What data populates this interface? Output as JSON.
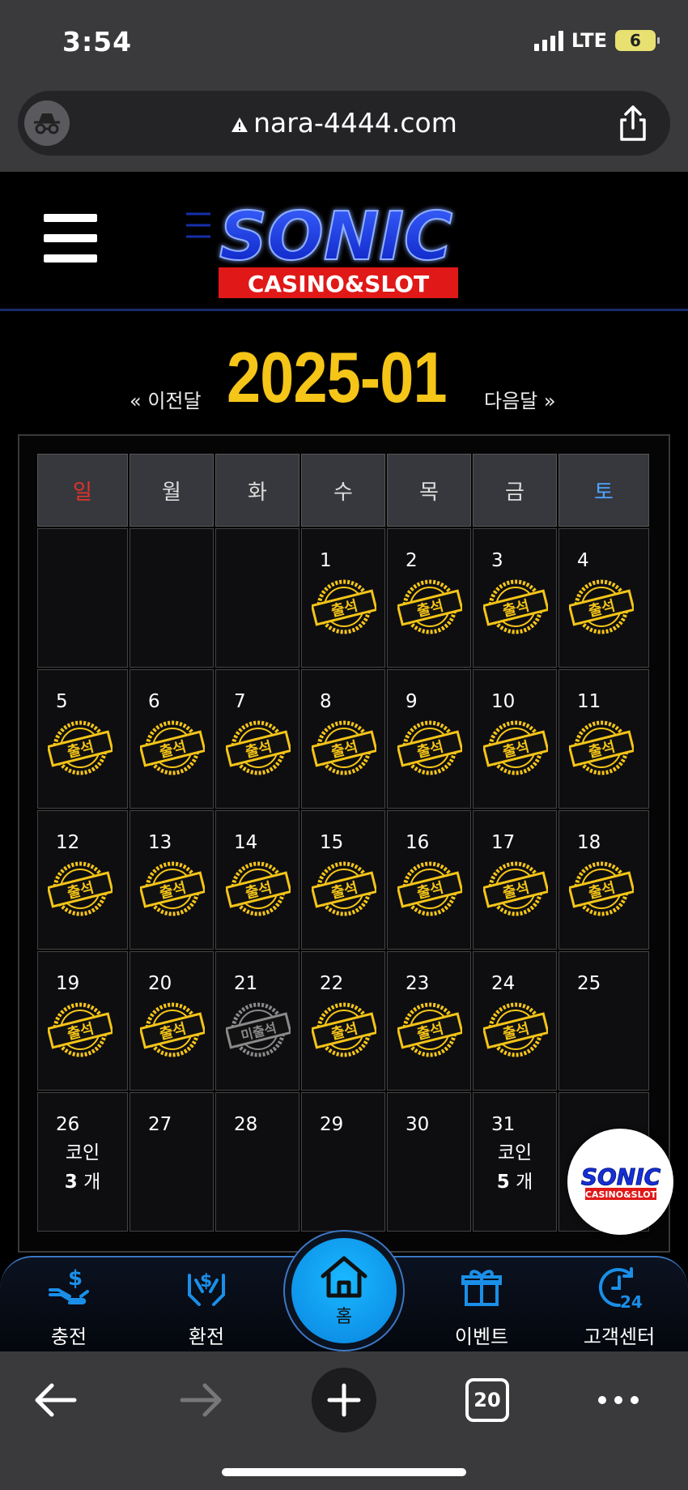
{
  "status_bar": {
    "time": "3:54",
    "network": "LTE",
    "battery": "6"
  },
  "browser": {
    "url": "nara-4444.com",
    "tabs_count": "20"
  },
  "site": {
    "logo_text": "SONIC",
    "logo_sub": "CASINO&SLOT"
  },
  "calendar": {
    "prev_label": "« 이전달",
    "next_label": "다음달 »",
    "month_title": "2025-01",
    "weekdays": [
      "일",
      "월",
      "화",
      "수",
      "목",
      "금",
      "토"
    ],
    "stamp_present": "출석",
    "stamp_absent": "미출석",
    "weeks": [
      [
        {
          "day": ""
        },
        {
          "day": ""
        },
        {
          "day": ""
        },
        {
          "day": "1",
          "status": "present"
        },
        {
          "day": "2",
          "status": "present"
        },
        {
          "day": "3",
          "status": "present"
        },
        {
          "day": "4",
          "status": "present"
        }
      ],
      [
        {
          "day": "5",
          "status": "present"
        },
        {
          "day": "6",
          "status": "present"
        },
        {
          "day": "7",
          "status": "present"
        },
        {
          "day": "8",
          "status": "present"
        },
        {
          "day": "9",
          "status": "present"
        },
        {
          "day": "10",
          "status": "present"
        },
        {
          "day": "11",
          "status": "present"
        }
      ],
      [
        {
          "day": "12",
          "status": "present"
        },
        {
          "day": "13",
          "status": "present"
        },
        {
          "day": "14",
          "status": "present"
        },
        {
          "day": "15",
          "status": "present"
        },
        {
          "day": "16",
          "status": "present"
        },
        {
          "day": "17",
          "status": "present"
        },
        {
          "day": "18",
          "status": "present"
        }
      ],
      [
        {
          "day": "19",
          "status": "present"
        },
        {
          "day": "20",
          "status": "present"
        },
        {
          "day": "21",
          "status": "absent"
        },
        {
          "day": "22",
          "status": "present"
        },
        {
          "day": "23",
          "status": "present"
        },
        {
          "day": "24",
          "status": "present"
        },
        {
          "day": "25"
        }
      ],
      [
        {
          "day": "26",
          "coin_label": "코인",
          "coin_count": "3",
          "coin_unit": "개"
        },
        {
          "day": "27"
        },
        {
          "day": "28"
        },
        {
          "day": "29"
        },
        {
          "day": "30"
        },
        {
          "day": "31",
          "coin_label": "코인",
          "coin_count": "5",
          "coin_unit": "개"
        },
        {
          "day": ""
        }
      ]
    ]
  },
  "bottom_nav": {
    "charge": "충전",
    "exchange": "환전",
    "home": "홈",
    "event": "이벤트",
    "support": "고객센터"
  },
  "colors": {
    "accent_gold": "#f5c518",
    "sunday": "#e0332c",
    "saturday": "#4ea3ff",
    "nav_blue": "#1a8fe8",
    "absent_gray": "#8a8a8a"
  }
}
